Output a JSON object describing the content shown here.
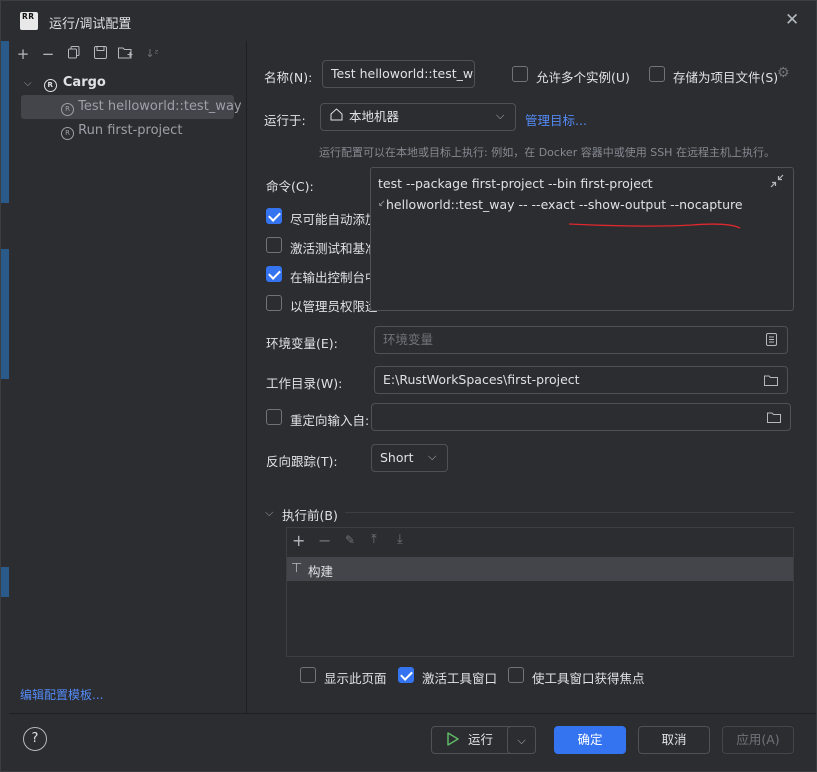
{
  "window": {
    "title": "运行/调试配置",
    "logo_text": "RR"
  },
  "left": {
    "tree": {
      "group": "Cargo",
      "items": [
        {
          "label": "Test helloworld::test_way",
          "selected": true
        },
        {
          "label": "Run first-project",
          "selected": false
        }
      ]
    },
    "edit_templates": "编辑配置模板..."
  },
  "form": {
    "name_label": "名称(N):",
    "name_value": "Test helloworld::test_way",
    "allow_multiple": "允许多个实例(U)",
    "store_as_file": "存储为项目文件(S)",
    "run_on_label": "运行于:",
    "run_on_value": "本地机器",
    "manage_targets": "管理目标...",
    "run_on_hint": "运行配置可以在本地或目标上执行: 例如，在 Docker 容器中或使用 SSH 在远程主机上执行。",
    "command_label": "命令(C):",
    "command_line1": "test --package first-project --bin first-project",
    "command_line2": "helloworld::test_way -- --exact --show-output --nocapture",
    "options": [
      {
        "label": "尽可能自动添加",
        "checked": true
      },
      {
        "label": "激活测试和基准",
        "checked": false
      },
      {
        "label": "在输出控制台中",
        "checked": true
      },
      {
        "label": "以管理员权限运",
        "checked": false
      }
    ],
    "env_label": "环境变量(E):",
    "env_placeholder": "环境变量",
    "workdir_label": "工作目录(W):",
    "workdir_value": "E:\\RustWorkSpaces\\first-project",
    "redirect_label": "重定向输入自:",
    "backtrace_label": "反向跟踪(T):",
    "backtrace_value": "Short",
    "before_label": "执行前(B)",
    "before_item": "构建",
    "show_page": "显示此页面",
    "activate_tool": "激活工具窗口",
    "focus_tool": "使工具窗口获得焦点"
  },
  "footer": {
    "help": "?",
    "run": "运行",
    "ok": "确定",
    "cancel": "取消",
    "apply": "应用(A)"
  },
  "colors": {
    "accent": "#3574f0",
    "link": "#548af7",
    "annotation": "#e0282e"
  }
}
